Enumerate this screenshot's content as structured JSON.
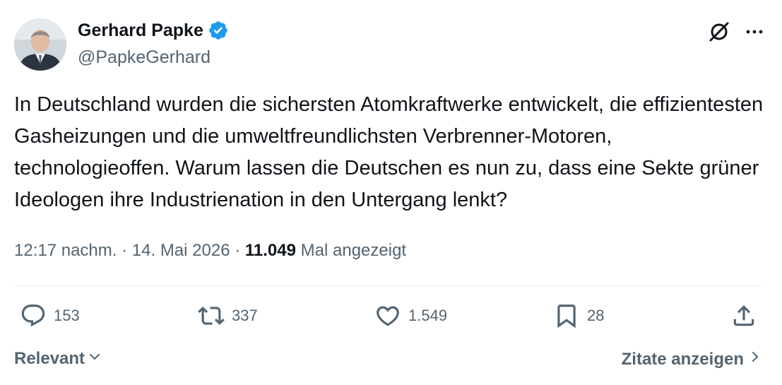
{
  "author": {
    "display_name": "Gerhard Papke",
    "handle": "@PapkeGerhard"
  },
  "tweet": {
    "text": "In Deutschland wurden die sichersten Atomkraftwerke entwickelt, die effizientesten Gasheizungen und die umweltfreundlichsten Verbrenner-Motoren, technologieoffen. Warum lassen die Deutschen es nun zu, dass eine Sekte grüner Ideologen ihre Industrienation in den Untergang lenkt?"
  },
  "meta": {
    "time": "12:17 nachm.",
    "separator": "·",
    "date": "14. Mai 2026",
    "views_count": "11.049",
    "views_label": "Mal angezeigt"
  },
  "actions": {
    "replies": "153",
    "reposts": "337",
    "likes": "1.549",
    "bookmarks": "28"
  },
  "footer": {
    "sort_label": "Relevant",
    "quotes_label": "Zitate anzeigen"
  },
  "colors": {
    "verified": "#1d9bf0",
    "secondary_text": "#536471",
    "primary_text": "#0f1419"
  },
  "icons": {
    "verified": "verified-badge-icon",
    "grok": "grok-icon",
    "more": "more-icon",
    "reply": "reply-icon",
    "repost": "repost-icon",
    "like": "heart-icon",
    "bookmark": "bookmark-icon",
    "share": "share-icon"
  }
}
